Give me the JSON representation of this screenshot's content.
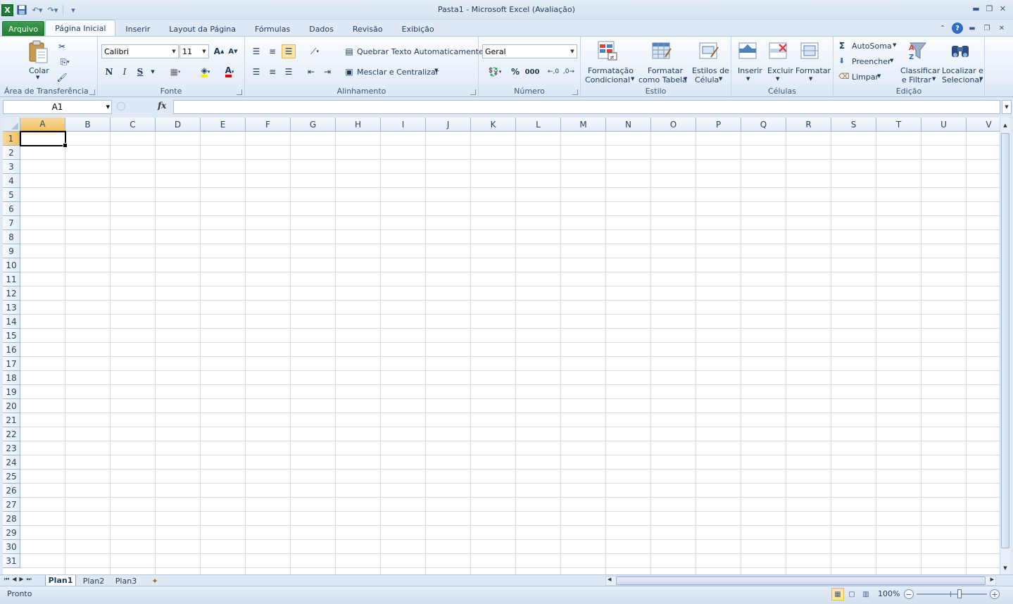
{
  "window": {
    "title": "Pasta1  -  Microsoft Excel (Avaliação)"
  },
  "tabs": [
    "Arquivo",
    "Página Inicial",
    "Inserir",
    "Layout da Página",
    "Fórmulas",
    "Dados",
    "Revisão",
    "Exibição"
  ],
  "clipboard": {
    "paste_label": "Colar",
    "group_label": "Área de Transferência"
  },
  "font": {
    "name": "Calibri",
    "size": "11",
    "bold": "N",
    "italic": "I",
    "underline": "S",
    "group_label": "Fonte"
  },
  "alignment": {
    "wrap_label": "Quebrar Texto Automaticamente",
    "merge_label": "Mesclar e Centralizar",
    "group_label": "Alinhamento"
  },
  "number": {
    "format": "Geral",
    "percent": "%",
    "thousands": "000",
    "group_label": "Número"
  },
  "styles": {
    "cond_line1": "Formatação",
    "cond_line2": "Condicional",
    "table_line1": "Formatar",
    "table_line2": "como Tabela",
    "cell_line1": "Estilos de",
    "cell_line2": "Célula",
    "group_label": "Estilo"
  },
  "cells": {
    "insert": "Inserir",
    "delete": "Excluir",
    "format": "Formatar",
    "group_label": "Células"
  },
  "editing": {
    "autosum": "AutoSoma",
    "fill": "Preencher",
    "clear": "Limpar",
    "sort_line1": "Classificar",
    "sort_line2": "e Filtrar",
    "find_line1": "Localizar e",
    "find_line2": "Selecionar",
    "group_label": "Edição"
  },
  "formula_bar": {
    "name_box": "A1",
    "fx": "fx",
    "value": ""
  },
  "columns": [
    "A",
    "B",
    "C",
    "D",
    "E",
    "F",
    "G",
    "H",
    "I",
    "J",
    "K",
    "L",
    "M",
    "N",
    "O",
    "P",
    "Q",
    "R",
    "S",
    "T",
    "U",
    "V"
  ],
  "rows": [
    "1",
    "2",
    "3",
    "4",
    "5",
    "6",
    "7",
    "8",
    "9",
    "10",
    "11",
    "12",
    "13",
    "14",
    "15",
    "16",
    "17",
    "18",
    "19",
    "20",
    "21",
    "22",
    "23",
    "24",
    "25",
    "26",
    "27",
    "28",
    "29",
    "30",
    "31"
  ],
  "active_cell": "A1",
  "sheets": [
    "Plan1",
    "Plan2",
    "Plan3"
  ],
  "active_sheet": "Plan1",
  "status": {
    "text": "Pronto",
    "zoom": "100%"
  }
}
